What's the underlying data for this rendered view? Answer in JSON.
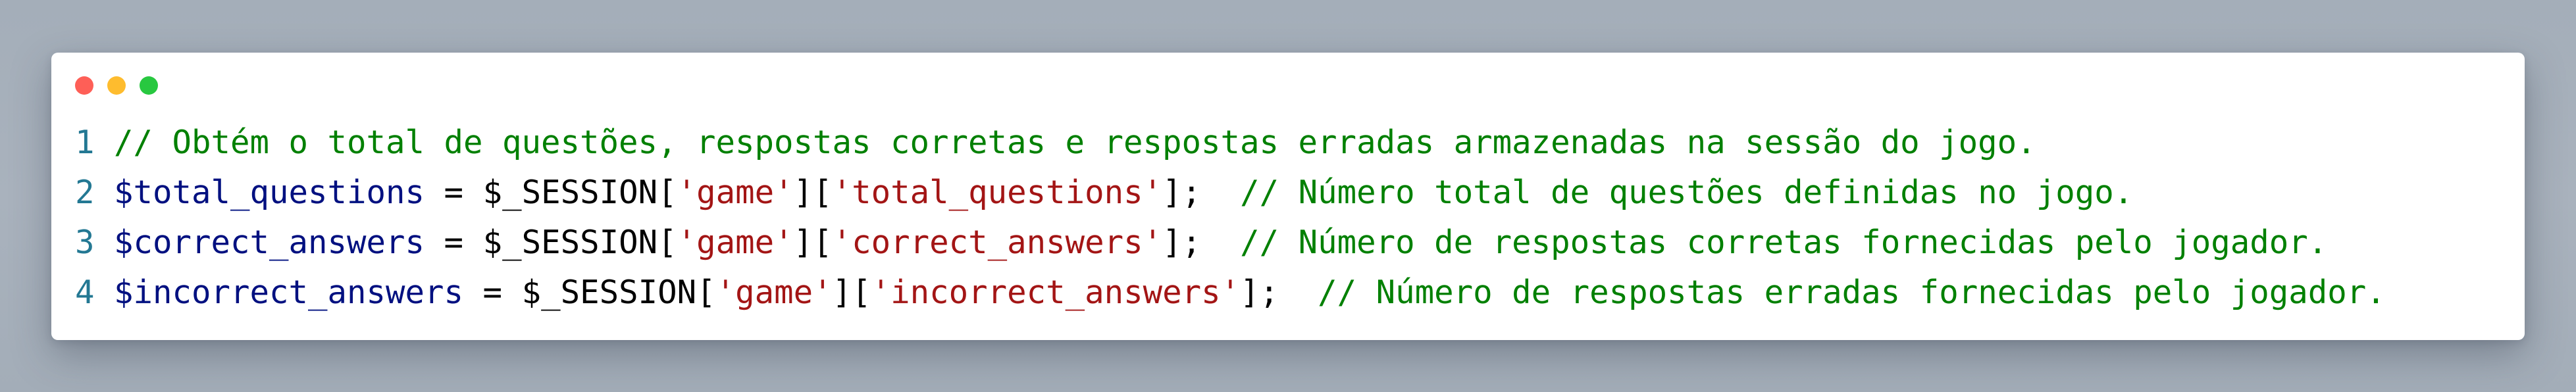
{
  "window": {
    "controls": [
      "close",
      "minimize",
      "maximize"
    ]
  },
  "colors": {
    "line_number": "#237893",
    "variable": "#001080",
    "string": "#a31515",
    "comment": "#008000",
    "plain": "#000000",
    "close": "#fe5f57",
    "minimize": "#febc2e",
    "maximize": "#28c840"
  },
  "code": {
    "lines": [
      {
        "number": "1",
        "comment": "// Obtém o total de questões, respostas corretas e respostas erradas armazenadas na sessão do jogo."
      },
      {
        "number": "2",
        "var": "$total_questions",
        "eq": " = ",
        "session": "$_SESSION",
        "b1": "[",
        "key1": "'game'",
        "b2": "][",
        "key2": "'total_questions'",
        "b3": "];",
        "gap": "  ",
        "comment": "// Número total de questões definidas no jogo."
      },
      {
        "number": "3",
        "var": "$correct_answers",
        "eq": " = ",
        "session": "$_SESSION",
        "b1": "[",
        "key1": "'game'",
        "b2": "][",
        "key2": "'correct_answers'",
        "b3": "];",
        "gap": "  ",
        "comment": "// Número de respostas corretas fornecidas pelo jogador."
      },
      {
        "number": "4",
        "var": "$incorrect_answers",
        "eq": " = ",
        "session": "$_SESSION",
        "b1": "[",
        "key1": "'game'",
        "b2": "][",
        "key2": "'incorrect_answers'",
        "b3": "];",
        "gap": "  ",
        "comment": "// Número de respostas erradas fornecidas pelo jogador."
      }
    ]
  }
}
